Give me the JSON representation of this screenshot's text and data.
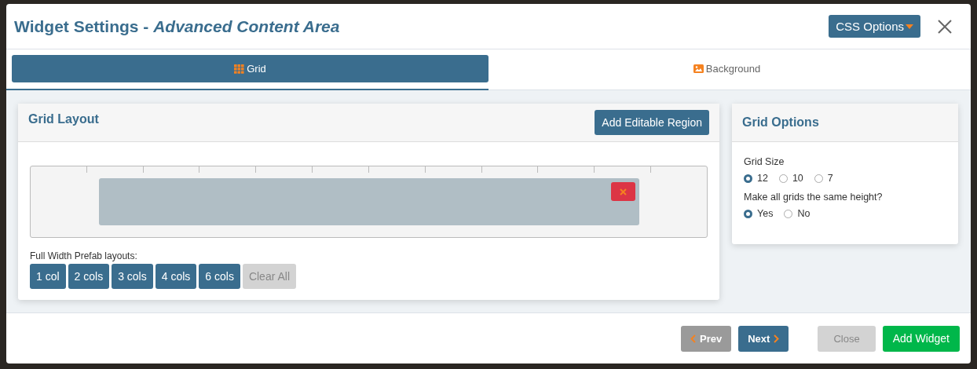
{
  "window": {
    "title": "Widget Settings - *Advanced Content Area*"
  },
  "css_options": {
    "label": "CSS Options"
  },
  "tabs": [
    {
      "label": "Grid",
      "selected": true,
      "kind": "grid"
    },
    {
      "label": "Background",
      "selected": false,
      "kind": "image"
    }
  ],
  "grid_layout": {
    "title": "Grid Layout",
    "add_button": "Add Editable Region",
    "prefab_label": "Full Width Prefab layouts:",
    "prefabs": [
      {
        "label": "1 col",
        "disabled": false
      },
      {
        "label": "2 cols",
        "disabled": false
      },
      {
        "label": "3 cols",
        "disabled": false
      },
      {
        "label": "4 cols",
        "disabled": false
      },
      {
        "label": "6 cols",
        "disabled": false
      },
      {
        "label": "Clear All",
        "disabled": true
      }
    ]
  },
  "grid_options": {
    "title": "Grid Options",
    "groups": [
      {
        "label": "Grid Size",
        "options": [
          {
            "label": "12",
            "selected": true
          },
          {
            "label": "10",
            "selected": false
          },
          {
            "label": "7",
            "selected": false
          }
        ]
      },
      {
        "label": "Make all grids the same height?",
        "options": [
          {
            "label": "Yes",
            "selected": true
          },
          {
            "label": "No",
            "selected": false
          }
        ]
      }
    ]
  },
  "footer": {
    "buttons": [
      {
        "label": "Prev",
        "kind": "prev"
      },
      {
        "label": "Next",
        "kind": "next"
      },
      {
        "label": "Close",
        "kind": "disabled"
      },
      {
        "label": "Add Widget",
        "kind": "success"
      }
    ]
  }
}
